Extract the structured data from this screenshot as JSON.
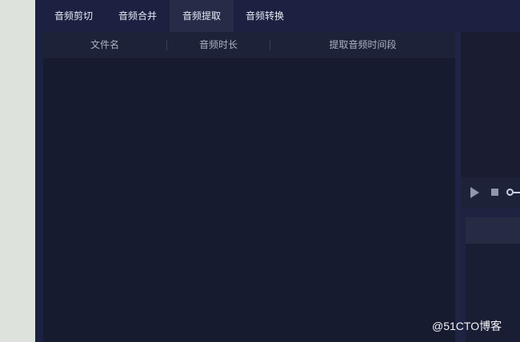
{
  "tabs": [
    {
      "label": "音频剪切"
    },
    {
      "label": "音频合并"
    },
    {
      "label": "音频提取",
      "active": true
    },
    {
      "label": "音频转换"
    }
  ],
  "table": {
    "columns": [
      "文件名",
      "音频时长",
      "提取音频时间段"
    ],
    "rows": []
  },
  "player": {
    "play_icon": "play-icon",
    "stop_icon": "stop-icon"
  },
  "watermark": "@51CTO博客",
  "colors": {
    "app_background": "#1c2140",
    "panel_background": "#171b30",
    "active_tab": "#262b48",
    "outer_background": "#dde3dc"
  }
}
